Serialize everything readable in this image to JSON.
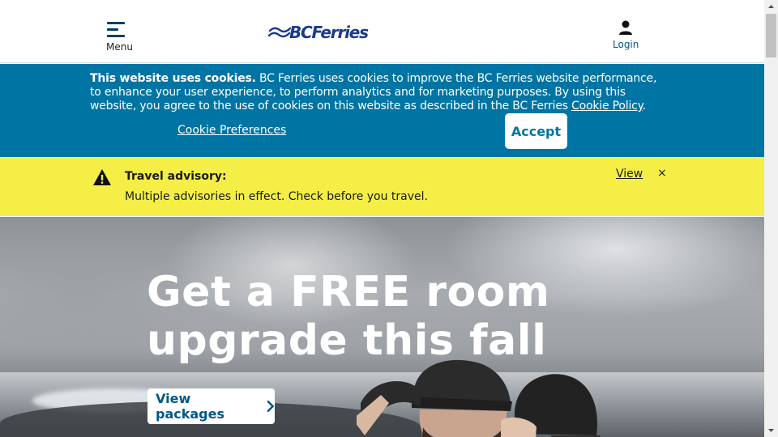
{
  "header": {
    "menu_label": "Menu",
    "logo_text": "BCFerries",
    "login_label": "Login",
    "brand_color": "#1a3a8c"
  },
  "cookie_banner": {
    "bold_lead": "This website uses cookies.",
    "body_text": " BC Ferries uses cookies to improve the BC Ferries website performance, to enhance your user experience, to perform analytics and for marketing purposes. By using this website, you agree to the use of cookies on this website as described in the BC Ferries ",
    "policy_link": "Cookie Policy",
    "period": ".",
    "preferences_link": "Cookie Preferences",
    "accept_label": "Accept",
    "background_color": "#0074a3"
  },
  "advisory": {
    "title": "Travel advisory:",
    "message": "Multiple advisories in effect. Check before you travel.",
    "view_link": "View",
    "close_symbol": "×",
    "background_color": "#f4ee47",
    "icon": "warning-icon"
  },
  "hero": {
    "title": "Get a FREE room upgrade this fall",
    "button_label": "View packages",
    "button_icon": "chevron-right-icon"
  }
}
